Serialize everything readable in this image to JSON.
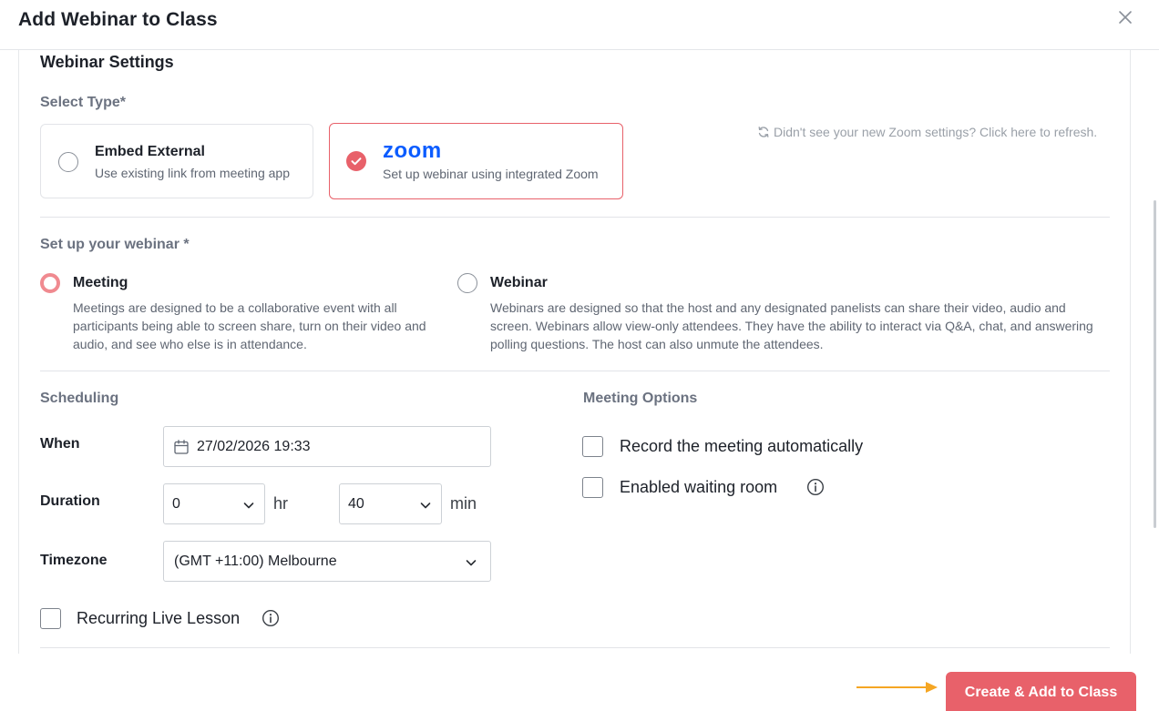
{
  "modal": {
    "title": "Add Webinar to Class"
  },
  "settings": {
    "title": "Webinar Settings",
    "select_type_label": "Select Type*",
    "refresh_text": "Didn't see your new Zoom settings? Click here to refresh.",
    "types": [
      {
        "title": "Embed External",
        "description": "Use existing link from meeting app",
        "selected": false
      },
      {
        "logo_text": "zoom",
        "description": "Set up webinar using integrated Zoom",
        "selected": true
      }
    ]
  },
  "setup": {
    "label": "Set up your webinar *",
    "options": [
      {
        "title": "Meeting",
        "description_lines": [
          "Meetings are designed to be a collaborative event with all",
          "participants being able to screen share, turn on their video and",
          "audio, and see who else is in attendance."
        ],
        "selected": true
      },
      {
        "title": "Webinar",
        "description_lines": [
          "Webinars are designed so that the host and any designated panelists can share their video, audio and",
          "screen. Webinars allow view-only attendees. They have the ability to interact via Q&A, chat, and answering",
          "polling questions. The host can also unmute the attendees."
        ],
        "selected": false
      }
    ]
  },
  "scheduling": {
    "title": "Scheduling",
    "when_label": "When",
    "when_value": "27/02/2026 19:33",
    "duration_label": "Duration",
    "duration_hours": "0",
    "hours_unit": "hr",
    "duration_minutes": "40",
    "minutes_unit": "min",
    "timezone_label": "Timezone",
    "timezone_value": "(GMT +11:00) Melbourne",
    "recurring_label": "Recurring Live Lesson"
  },
  "meeting_options": {
    "title": "Meeting Options",
    "record_label": "Record the meeting automatically",
    "waiting_room_label": "Enabled waiting room"
  },
  "footer": {
    "primary_label": "Create & Add to Class"
  },
  "colors": {
    "accent": "#e8616a",
    "arrow": "#f5a623",
    "zoom_blue": "#0b5cff"
  }
}
